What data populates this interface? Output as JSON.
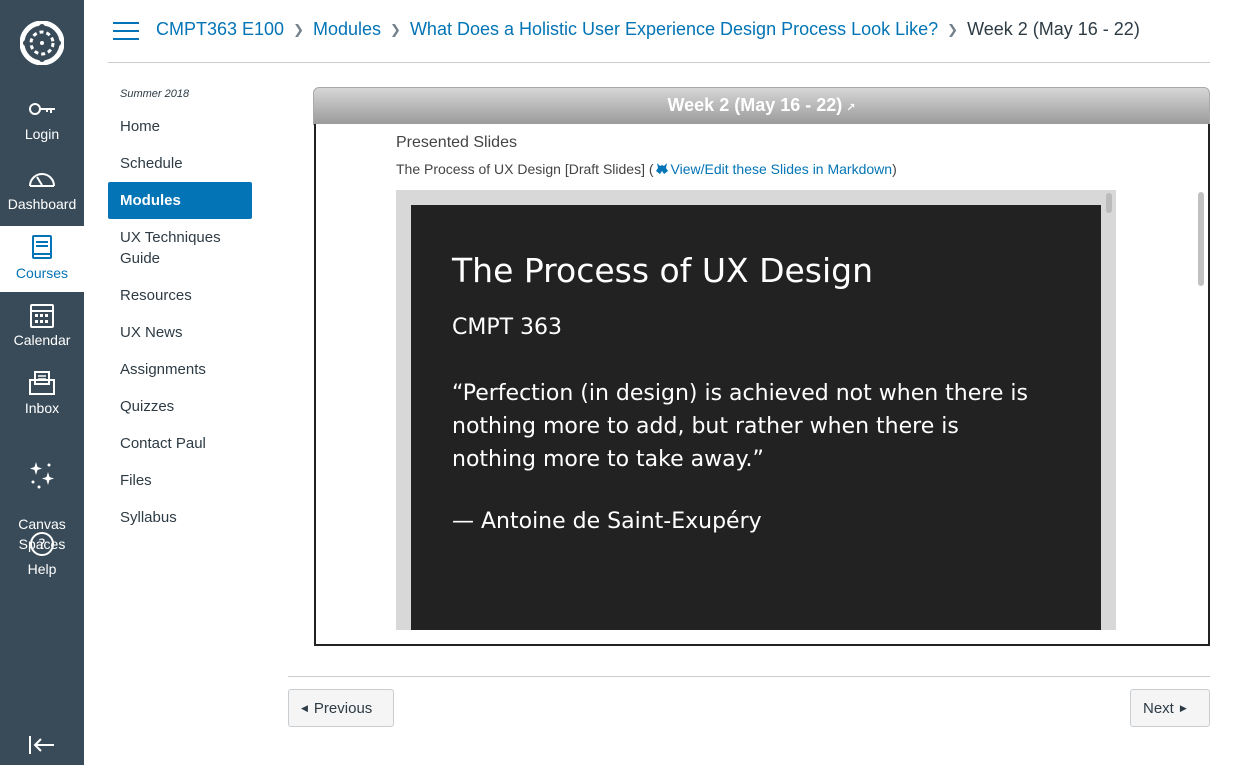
{
  "global_nav": {
    "items": [
      {
        "label": "Login",
        "icon": "key-icon"
      },
      {
        "label": "Dashboard",
        "icon": "dashboard-icon"
      },
      {
        "label": "Courses",
        "icon": "courses-icon"
      },
      {
        "label": "Calendar",
        "icon": "calendar-icon"
      },
      {
        "label": "Inbox",
        "icon": "inbox-icon"
      },
      {
        "label": "Canvas\nSpaces",
        "icon": "sparkle-icon"
      },
      {
        "label": "Help",
        "icon": "help-icon"
      }
    ],
    "active": "Courses",
    "colors": {
      "background": "#394b58",
      "active_text": "#0374b5"
    }
  },
  "breadcrumbs": {
    "course": "CMPT363 E100",
    "modules": "Modules",
    "module": "What Does a Holistic User Experience Design Process Look Like?",
    "current": "Week 2 (May 16 - 22)"
  },
  "course_nav": {
    "term": "Summer 2018",
    "items": [
      {
        "label": "Home"
      },
      {
        "label": "Schedule"
      },
      {
        "label": "Modules",
        "active": true
      },
      {
        "label": "UX Techniques Guide"
      },
      {
        "label": "Resources"
      },
      {
        "label": "UX News"
      },
      {
        "label": "Assignments"
      },
      {
        "label": "Quizzes"
      },
      {
        "label": "Contact Paul"
      },
      {
        "label": "Files"
      },
      {
        "label": "Syllabus"
      }
    ],
    "accent": "#0374b5"
  },
  "content": {
    "frame_title": "Week 2 (May 16 - 22)",
    "section_title": "Presented Slides",
    "slides_label": "The Process of UX Design [Draft Slides] (",
    "slides_link": "View/Edit these Slides in Markdown",
    "slides_close": ")",
    "slide": {
      "title": "The Process of UX Design",
      "subtitle": "CMPT 363",
      "quote": "“Perfection (in design) is achieved not when there is nothing more to add, but rather when there is nothing more to take away.”",
      "author": "— Antoine de Saint-Exupéry"
    }
  },
  "footer": {
    "previous": "Previous",
    "next": "Next"
  }
}
